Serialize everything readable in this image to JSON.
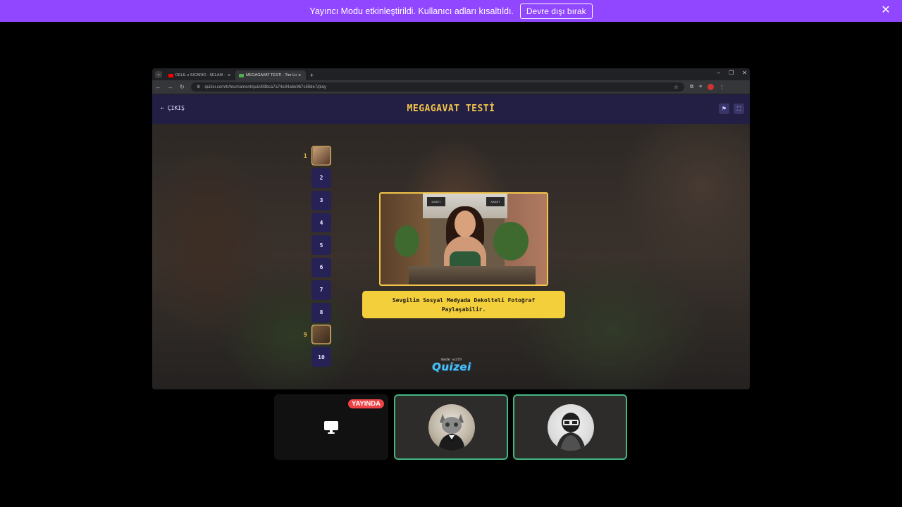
{
  "banner": {
    "message": "Yayıncı Modu etkinleştirildi. Kullanıcı adları kısaltıldı.",
    "disable_label": "Devre dışı bırak"
  },
  "browser": {
    "tabs": [
      {
        "title": "DELIL x SICARIO - SELAM - You",
        "favicon": "youtube-icon"
      },
      {
        "title": "MEGAGAVAT TESTİ - Tier List, ",
        "favicon": "quizei-icon"
      }
    ],
    "url": "quizei.com/tr/tournament/quiz/69bca7a74e34a6e967c59de7/play"
  },
  "page": {
    "back_label": "ÇIKIŞ",
    "title": "MEGAGAVAT TESTİ",
    "ranks": [
      {
        "label": "1",
        "filled": true
      },
      {
        "label": "2",
        "filled": false
      },
      {
        "label": "3",
        "filled": false
      },
      {
        "label": "4",
        "filled": false
      },
      {
        "label": "5",
        "filled": false
      },
      {
        "label": "6",
        "filled": false
      },
      {
        "label": "7",
        "filled": false
      },
      {
        "label": "8",
        "filled": false
      },
      {
        "label": "9",
        "filled": true
      },
      {
        "label": "10",
        "filled": false
      }
    ],
    "photo_sign_1": "KASET",
    "photo_sign_2": "KASET",
    "caption": "Sevgilim Sosyal Medyada Dekolteli Fotoğraf Paylaşabilir.",
    "made_with": "made with",
    "brand": "Quizei"
  },
  "call": {
    "live_badge": "YAYINDA"
  },
  "colors": {
    "banner": "#9146ff",
    "title": "#f2c54a",
    "caption_bg": "#f4cf3c",
    "speaking": "#43b581",
    "live": "#ed4245"
  }
}
